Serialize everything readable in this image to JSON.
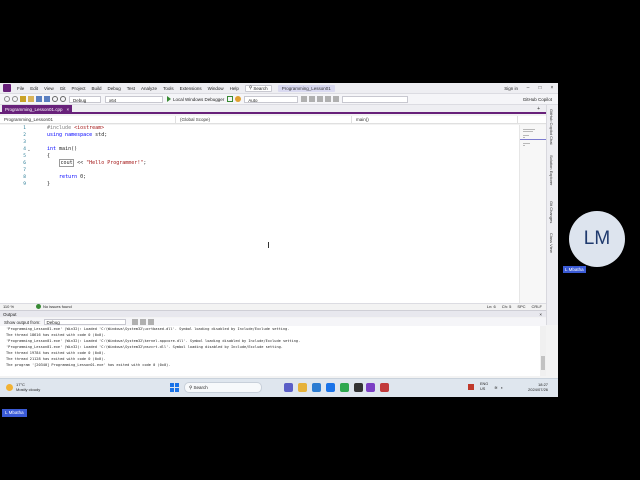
{
  "menubar": {
    "items": [
      "File",
      "Edit",
      "View",
      "Git",
      "Project",
      "Build",
      "Debug",
      "Test",
      "Analyze",
      "Tools",
      "Extensions",
      "Window",
      "Help"
    ],
    "search_label": "Search",
    "project_title": "Programming_Lesson01",
    "signin": "Sign in"
  },
  "toolbar": {
    "config": "Debug",
    "platform": "x64",
    "debugger_label": "Local Windows Debugger",
    "dropdown3": "Auto",
    "copilot": "GitHub Copilot"
  },
  "editor": {
    "tab_label": "Programming_Lesson01.cpp",
    "nav_project": "Programming_Lesson01",
    "nav_scope": "(Global Scope)",
    "nav_member": "main()",
    "lines": [
      {
        "num": "1",
        "pre": "#include ",
        "kw": "",
        "rest": "<iostream>"
      },
      {
        "num": "2",
        "pre": "",
        "kw": "using namespace ",
        "rest": "std;"
      },
      {
        "num": "3",
        "pre": "",
        "kw": "",
        "rest": ""
      },
      {
        "num": "4",
        "pre": "",
        "kw": "int ",
        "rest": "main()"
      },
      {
        "num": "5",
        "pre": "",
        "kw": "",
        "rest": "{"
      },
      {
        "num": "6",
        "pre": "",
        "kw": "",
        "rest": "    cout << \"Hello Programmer!\";"
      },
      {
        "num": "7",
        "pre": "",
        "kw": "",
        "rest": ""
      },
      {
        "num": "8",
        "pre": "",
        "kw": "",
        "rest": "    return 0;"
      },
      {
        "num": "9",
        "pre": "",
        "kw": "",
        "rest": "}"
      }
    ]
  },
  "side_tabs": [
    "GitHub Copilot Chat",
    "Solution Explorer",
    "Git Changes",
    "Class View"
  ],
  "status": {
    "zoom": "110 %",
    "issues": "No issues found",
    "ln": "Ln: 6",
    "ch": "Ch: 5",
    "spc": "SPC",
    "crlf": "CRLF"
  },
  "output": {
    "panel_title": "Output",
    "show_from_label": "Show output from:",
    "source": "Debug",
    "lines": [
      "'Programming_Lesson01.exe' (Win32): Loaded 'C:\\Windows\\System32\\ucrtbased.dll'. Symbol loading disabled by Include/Exclude setting.",
      "The thread 18616 has exited with code 0 (0x0).",
      "'Programming_Lesson01.exe' (Win32): Loaded 'C:\\Windows\\System32\\kernel.appcore.dll'. Symbol loading disabled by Include/Exclude setting.",
      "'Programming_Lesson01.exe' (Win32): Loaded 'C:\\Windows\\System32\\msvcrt.dll'. Symbol loading disabled by Include/Exclude setting.",
      "The thread 19784 has exited with code 0 (0x0).",
      "The thread 21128 has exited with code 0 (0x0).",
      "The program '[20340] Programming_Lesson01.exe' has exited with code 0 (0x0)."
    ]
  },
  "taskbar": {
    "temp": "17°C",
    "weather": "Mostly cloudy",
    "search": "Search",
    "lang1": "ENG",
    "lang2": "US",
    "time": "18:27",
    "date": "2024/07/26"
  },
  "participants": {
    "initials": "LM",
    "right_name": "L Mbatha",
    "left_name": "L Mbatha"
  },
  "colors": {
    "vs_accent": "#68217a",
    "keyword": "#0000ff",
    "string": "#a31515",
    "line_number": "#237893",
    "name_tag": "#3b5bd6"
  }
}
